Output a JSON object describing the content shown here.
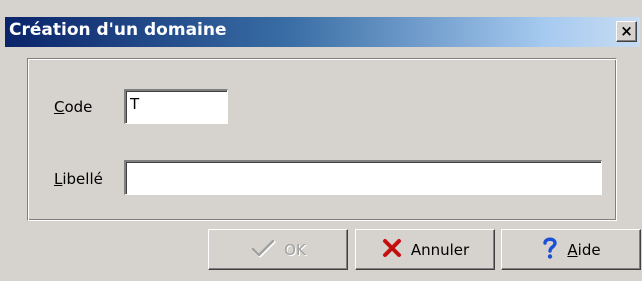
{
  "window": {
    "title": "Création d'un domaine",
    "close_glyph": "×"
  },
  "form": {
    "code": {
      "label_mnemonic": "C",
      "label_rest": "ode",
      "value": "T"
    },
    "libelle": {
      "label_mnemonic": "L",
      "label_rest": "ibellé",
      "value": ""
    }
  },
  "buttons": {
    "ok": {
      "label": "OK",
      "icon": "checkmark-icon",
      "enabled": false
    },
    "cancel": {
      "label": "Annuler",
      "icon": "red-x-icon"
    },
    "help": {
      "label_mnemonic": "A",
      "label_rest": "ide",
      "icon": "question-mark-icon"
    }
  },
  "colors": {
    "title_bar_start": "#0a246a",
    "title_bar_end": "#c8dcf2",
    "face": "#d6d3ce",
    "cancel_icon": "#cc1010",
    "help_icon": "#1a4fd6"
  }
}
